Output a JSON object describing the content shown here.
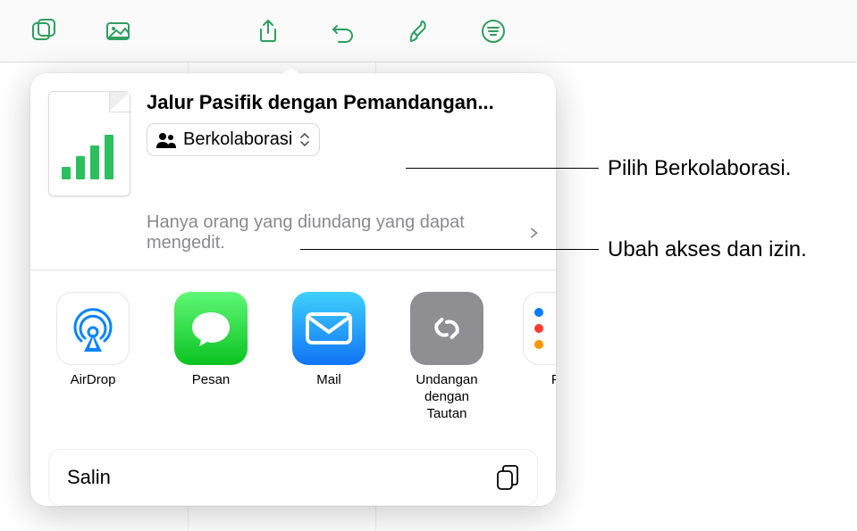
{
  "toolbar": {
    "items": [
      "add-shape",
      "media",
      "share",
      "undo",
      "format",
      "more"
    ]
  },
  "popover": {
    "docTitle": "Jalur Pasifik dengan Pemandangan...",
    "collab": {
      "label": "Berkolaborasi"
    },
    "permissionText": "Hanya orang yang diundang yang dapat mengedit.",
    "apps": [
      {
        "id": "airdrop",
        "label": "AirDrop"
      },
      {
        "id": "messages",
        "label": "Pesan"
      },
      {
        "id": "mail",
        "label": "Mail"
      },
      {
        "id": "invite-link",
        "label": "Undangan dengan Tautan"
      },
      {
        "id": "reminders",
        "label": "Pe"
      }
    ],
    "copyAction": "Salin"
  },
  "callouts": {
    "collab": "Pilih Berkolaborasi.",
    "permission": "Ubah akses dan izin."
  }
}
